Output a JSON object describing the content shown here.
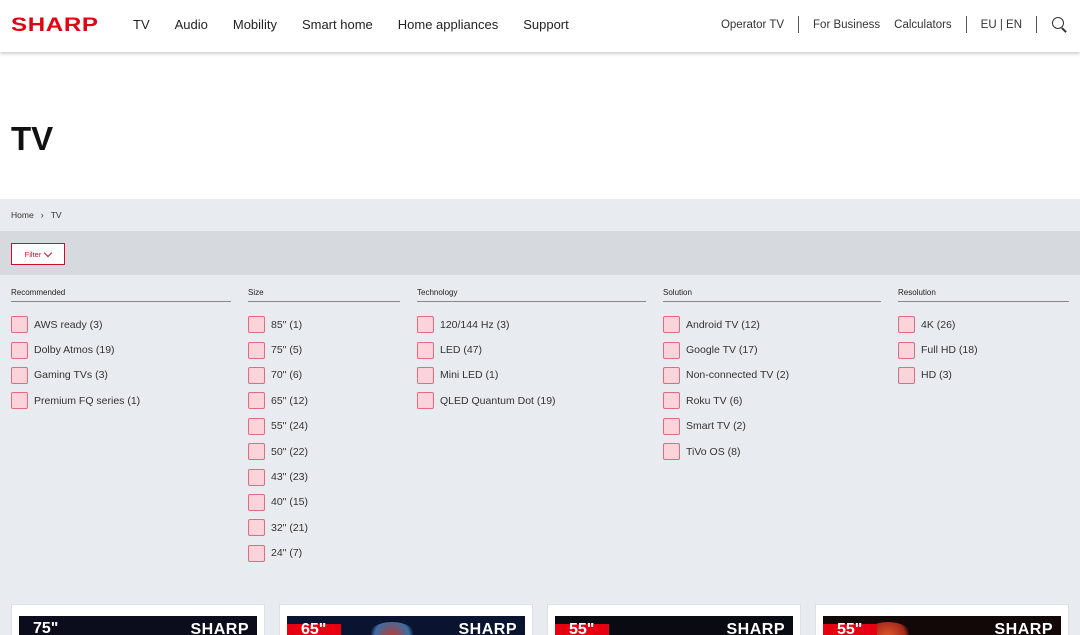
{
  "header": {
    "logo": "SHARP",
    "nav": [
      "TV",
      "Audio",
      "Mobility",
      "Smart home",
      "Home appliances",
      "Support"
    ],
    "util": {
      "operator": "Operator TV",
      "business": "For Business",
      "calculators": "Calculators",
      "region": "EU | EN"
    }
  },
  "page": {
    "title": "TV"
  },
  "breadcrumb": {
    "home": "Home",
    "current": "TV"
  },
  "filter": {
    "button_label": "Filter"
  },
  "filters": [
    {
      "title": "Recommended",
      "options": [
        "AWS ready (3)",
        "Dolby Atmos (19)",
        "Gaming TVs (3)",
        "Premium FQ series (1)"
      ]
    },
    {
      "title": "Size",
      "options": [
        "85\" (1)",
        "75\" (5)",
        "70\" (6)",
        "65\" (12)",
        "55\" (24)",
        "50\" (22)",
        "43\" (23)",
        "40\" (15)",
        "32\" (21)",
        "24\" (7)"
      ]
    },
    {
      "title": "Technology",
      "options": [
        "120/144 Hz (3)",
        "LED (47)",
        "Mini LED (1)",
        "QLED Quantum Dot (19)"
      ]
    },
    {
      "title": "Solution",
      "options": [
        "Android TV (12)",
        "Google TV (17)",
        "Non-connected TV (2)",
        "Roku TV (6)",
        "Smart TV (2)",
        "TiVo OS (8)"
      ]
    },
    {
      "title": "Resolution",
      "options": [
        "4K (26)",
        "Full HD (18)",
        "HD (3)"
      ]
    }
  ],
  "products": [
    {
      "size": "75\"",
      "brand": "SHARP"
    },
    {
      "size": "65\"",
      "brand": "SHARP"
    },
    {
      "size": "55\"",
      "brand": "SHARP"
    },
    {
      "size": "55\"",
      "brand": "SHARP"
    }
  ],
  "colors": {
    "brand": "#e60012",
    "checkbox_fill": "#fbd3da",
    "checkbox_border": "#e36a7f"
  }
}
